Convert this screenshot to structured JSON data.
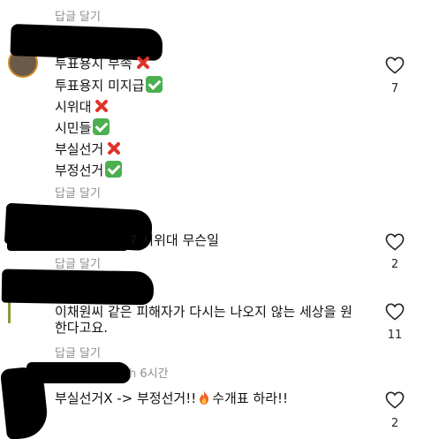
{
  "reply_label": "답글 달기",
  "comments": [
    {
      "lines": [
        "투표용지 부족",
        "투표용지 미지급",
        "시위대",
        "시민들",
        "부실선거",
        "부정선거"
      ],
      "likes": "7"
    },
    {
      "text": "7 시위대 무슨일",
      "likes": "2"
    },
    {
      "line1": "이채원씨 같은 피해자가 다시는 나오지 않는 세상을 원",
      "line2": "한다고요.",
      "likes": "11"
    },
    {
      "username_tail": "h",
      "time": "6시간",
      "text_part1": "부실선거X -> 부정선거!!",
      "text_part2": "수개표 하라!!",
      "likes": "2"
    }
  ],
  "colors": {
    "meta_gray": "#8e8e8e",
    "red_x": "#e0332b",
    "green_check": "#4caf50"
  },
  "icons": [
    "heart-icon",
    "cross-mark-icon",
    "check-mark-icon",
    "fire-icon"
  ]
}
